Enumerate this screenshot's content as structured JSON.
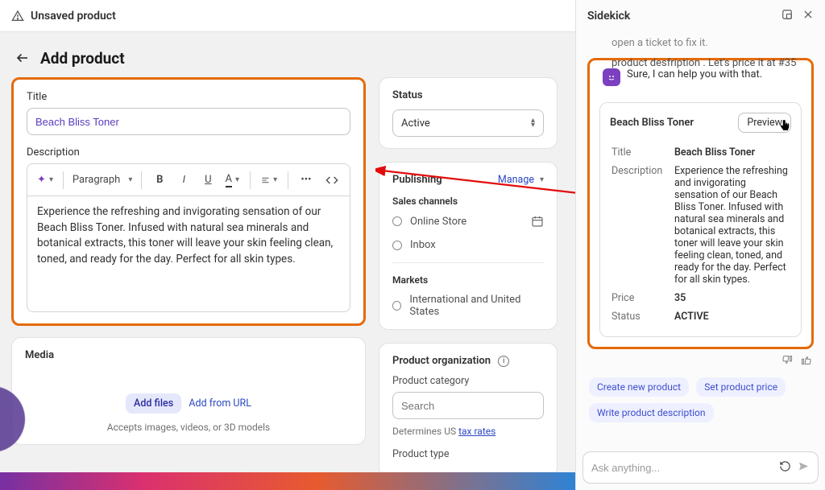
{
  "topbar": {
    "title": "Unsaved product"
  },
  "header": {
    "title": "Add product"
  },
  "title_section": {
    "label": "Title",
    "value": "Beach Bliss Toner",
    "desc_label": "Description",
    "paragraph_label": "Paragraph",
    "description": "Experience the refreshing and invigorating sensation of our Beach Bliss Toner. Infused with natural sea minerals and botanical extracts, this toner will leave your skin feeling clean, toned, and ready for the day. Perfect for all skin types."
  },
  "media": {
    "heading": "Media",
    "add_files": "Add files",
    "add_url": "Add from URL",
    "hint": "Accepts images, videos, or 3D models"
  },
  "status": {
    "heading": "Status",
    "value": "Active"
  },
  "publishing": {
    "heading": "Publishing",
    "manage": "Manage",
    "sales_channels": "Sales channels",
    "online_store": "Online Store",
    "inbox": "Inbox",
    "markets": "Markets",
    "intl": "International and United States"
  },
  "product_org": {
    "heading": "Product organization",
    "category_label": "Product category",
    "category_placeholder": "Search",
    "tax_hint_prefix": "Determines US ",
    "tax_link": "tax rates",
    "type_label": "Product type"
  },
  "sidekick": {
    "title": "Sidekick",
    "prev1": "open a ticket to fix it.",
    "prev2": "product desfription . Let's price it at #35",
    "reply": "Sure, I can help you with that.",
    "card": {
      "title": "Beach Bliss Toner",
      "preview": "Preview",
      "rows": {
        "title_k": "Title",
        "title_v": "Beach Bliss Toner",
        "desc_k": "Description",
        "desc_v": "Experience the refreshing and invigorating sensation of our Beach Bliss Toner. Infused with natural sea minerals and botanical extracts, this toner will leave your skin feeling clean, toned, and ready for the day. Perfect for all skin types.",
        "price_k": "Price",
        "price_v": "35",
        "status_k": "Status",
        "status_v": "ACTIVE"
      }
    },
    "chips": {
      "c1": "Create new product",
      "c2": "Set product price",
      "c3": "Write product description"
    },
    "ask_placeholder": "Ask anything..."
  }
}
